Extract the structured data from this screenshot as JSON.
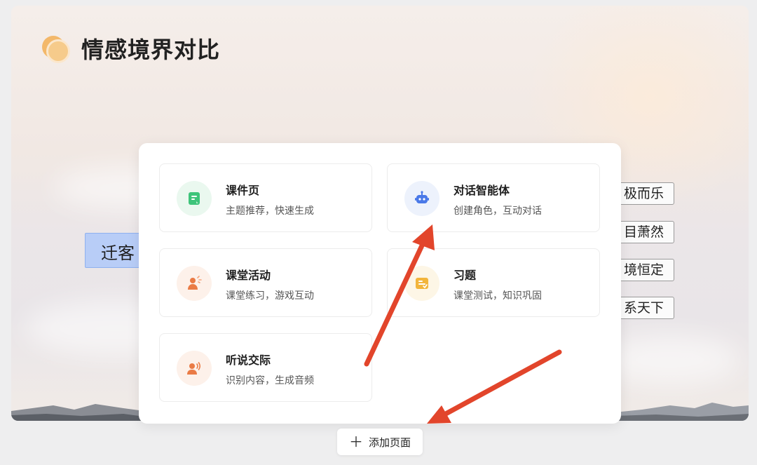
{
  "slide": {
    "title": "情感境界对比",
    "left_tag": "迁客",
    "right_tags": [
      "极而乐",
      "目萧然",
      "境恒定",
      "系天下"
    ]
  },
  "menu": {
    "cards": [
      {
        "title": "课件页",
        "desc": "主题推荐，快速生成",
        "icon": "courseware-page-icon",
        "color": "#3ec47a",
        "bg": "#eaf8ef"
      },
      {
        "title": "对话智能体",
        "desc": "创建角色，互动对话",
        "icon": "chat-bot-icon",
        "color": "#4a79e8",
        "bg": "#edf2fc"
      },
      {
        "title": "课堂活动",
        "desc": "课堂练习，游戏互动",
        "icon": "classroom-activity-icon",
        "color": "#ea7b45",
        "bg": "#fdf1ea"
      },
      {
        "title": "习题",
        "desc": "课堂测试，知识巩固",
        "icon": "exercise-icon",
        "color": "#f2b53c",
        "bg": "#fdf6e6"
      },
      {
        "title": "听说交际",
        "desc": "识别内容，生成音频",
        "icon": "listening-speaking-icon",
        "color": "#ea7b45",
        "bg": "#fdf1ea"
      }
    ]
  },
  "add_page": {
    "label": "添加页面"
  },
  "colors": {
    "arrow": "#e2452b",
    "tag_highlight": "#b8cdf7"
  }
}
